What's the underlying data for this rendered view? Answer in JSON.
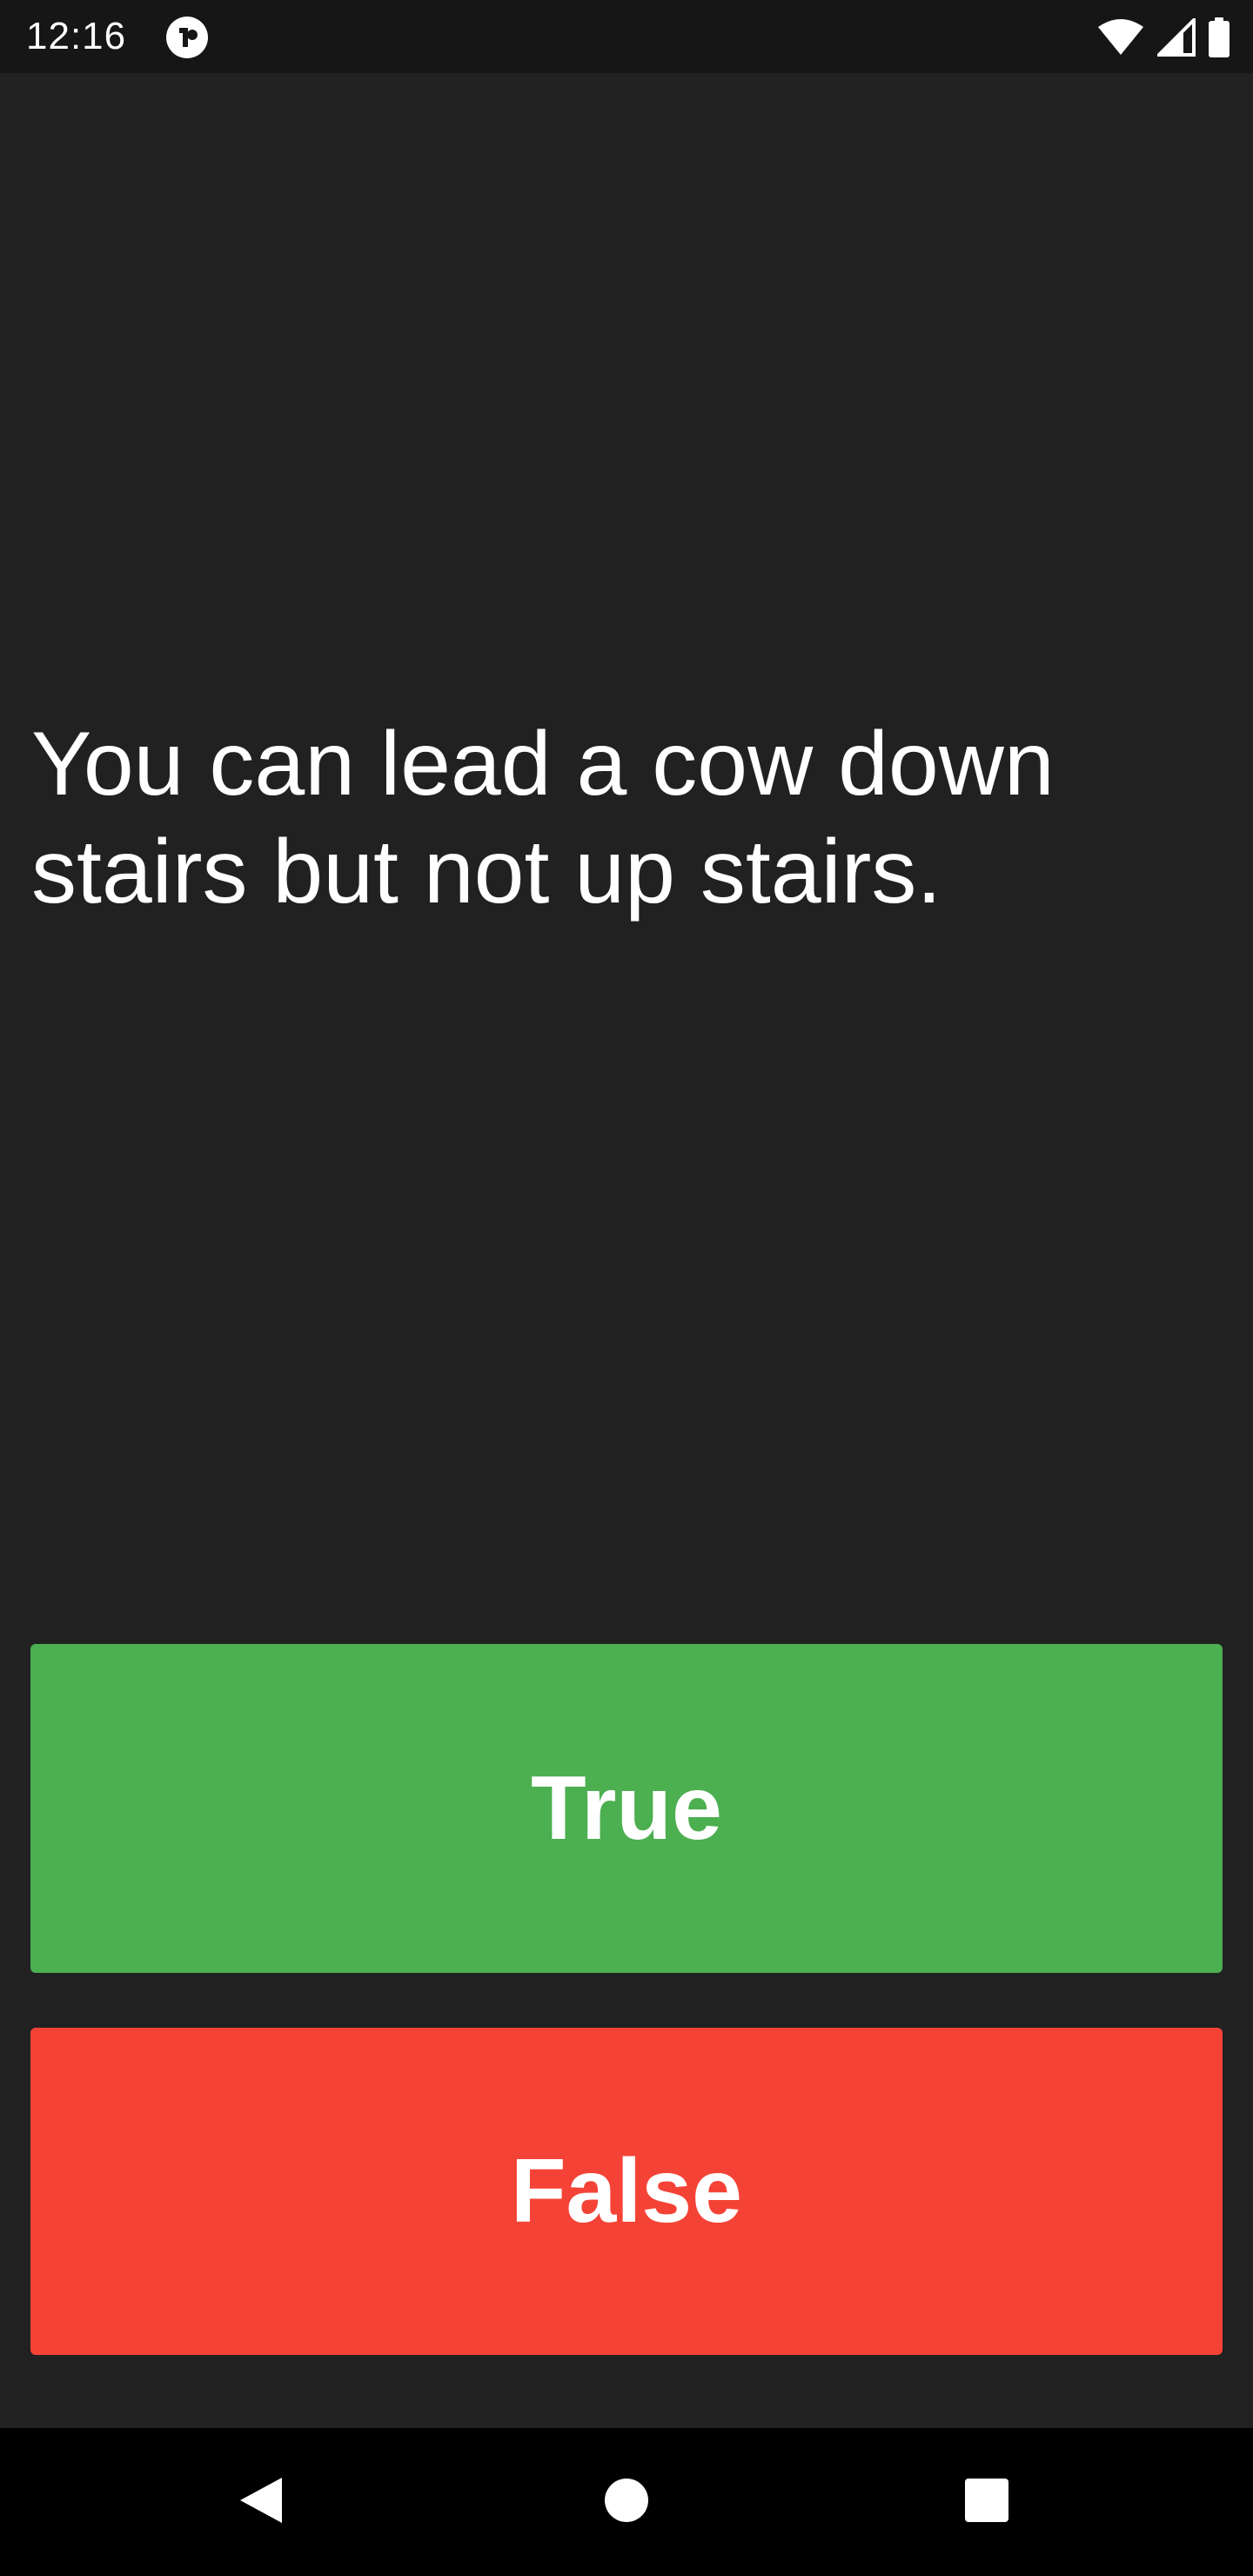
{
  "status_bar": {
    "time": "12:16",
    "icons": [
      "app-notification-icon",
      "wifi-icon",
      "cellular-signal-icon",
      "battery-icon"
    ]
  },
  "quiz": {
    "question": "You can lead a cow down stairs but not up stairs.",
    "true_label": "True",
    "false_label": "False"
  },
  "colors": {
    "background": "#212121",
    "true_button": "#4caf50",
    "false_button": "#f44336",
    "text": "#ffffff"
  },
  "nav_bar": {
    "icons": [
      "back-icon",
      "home-icon",
      "recents-icon"
    ]
  }
}
